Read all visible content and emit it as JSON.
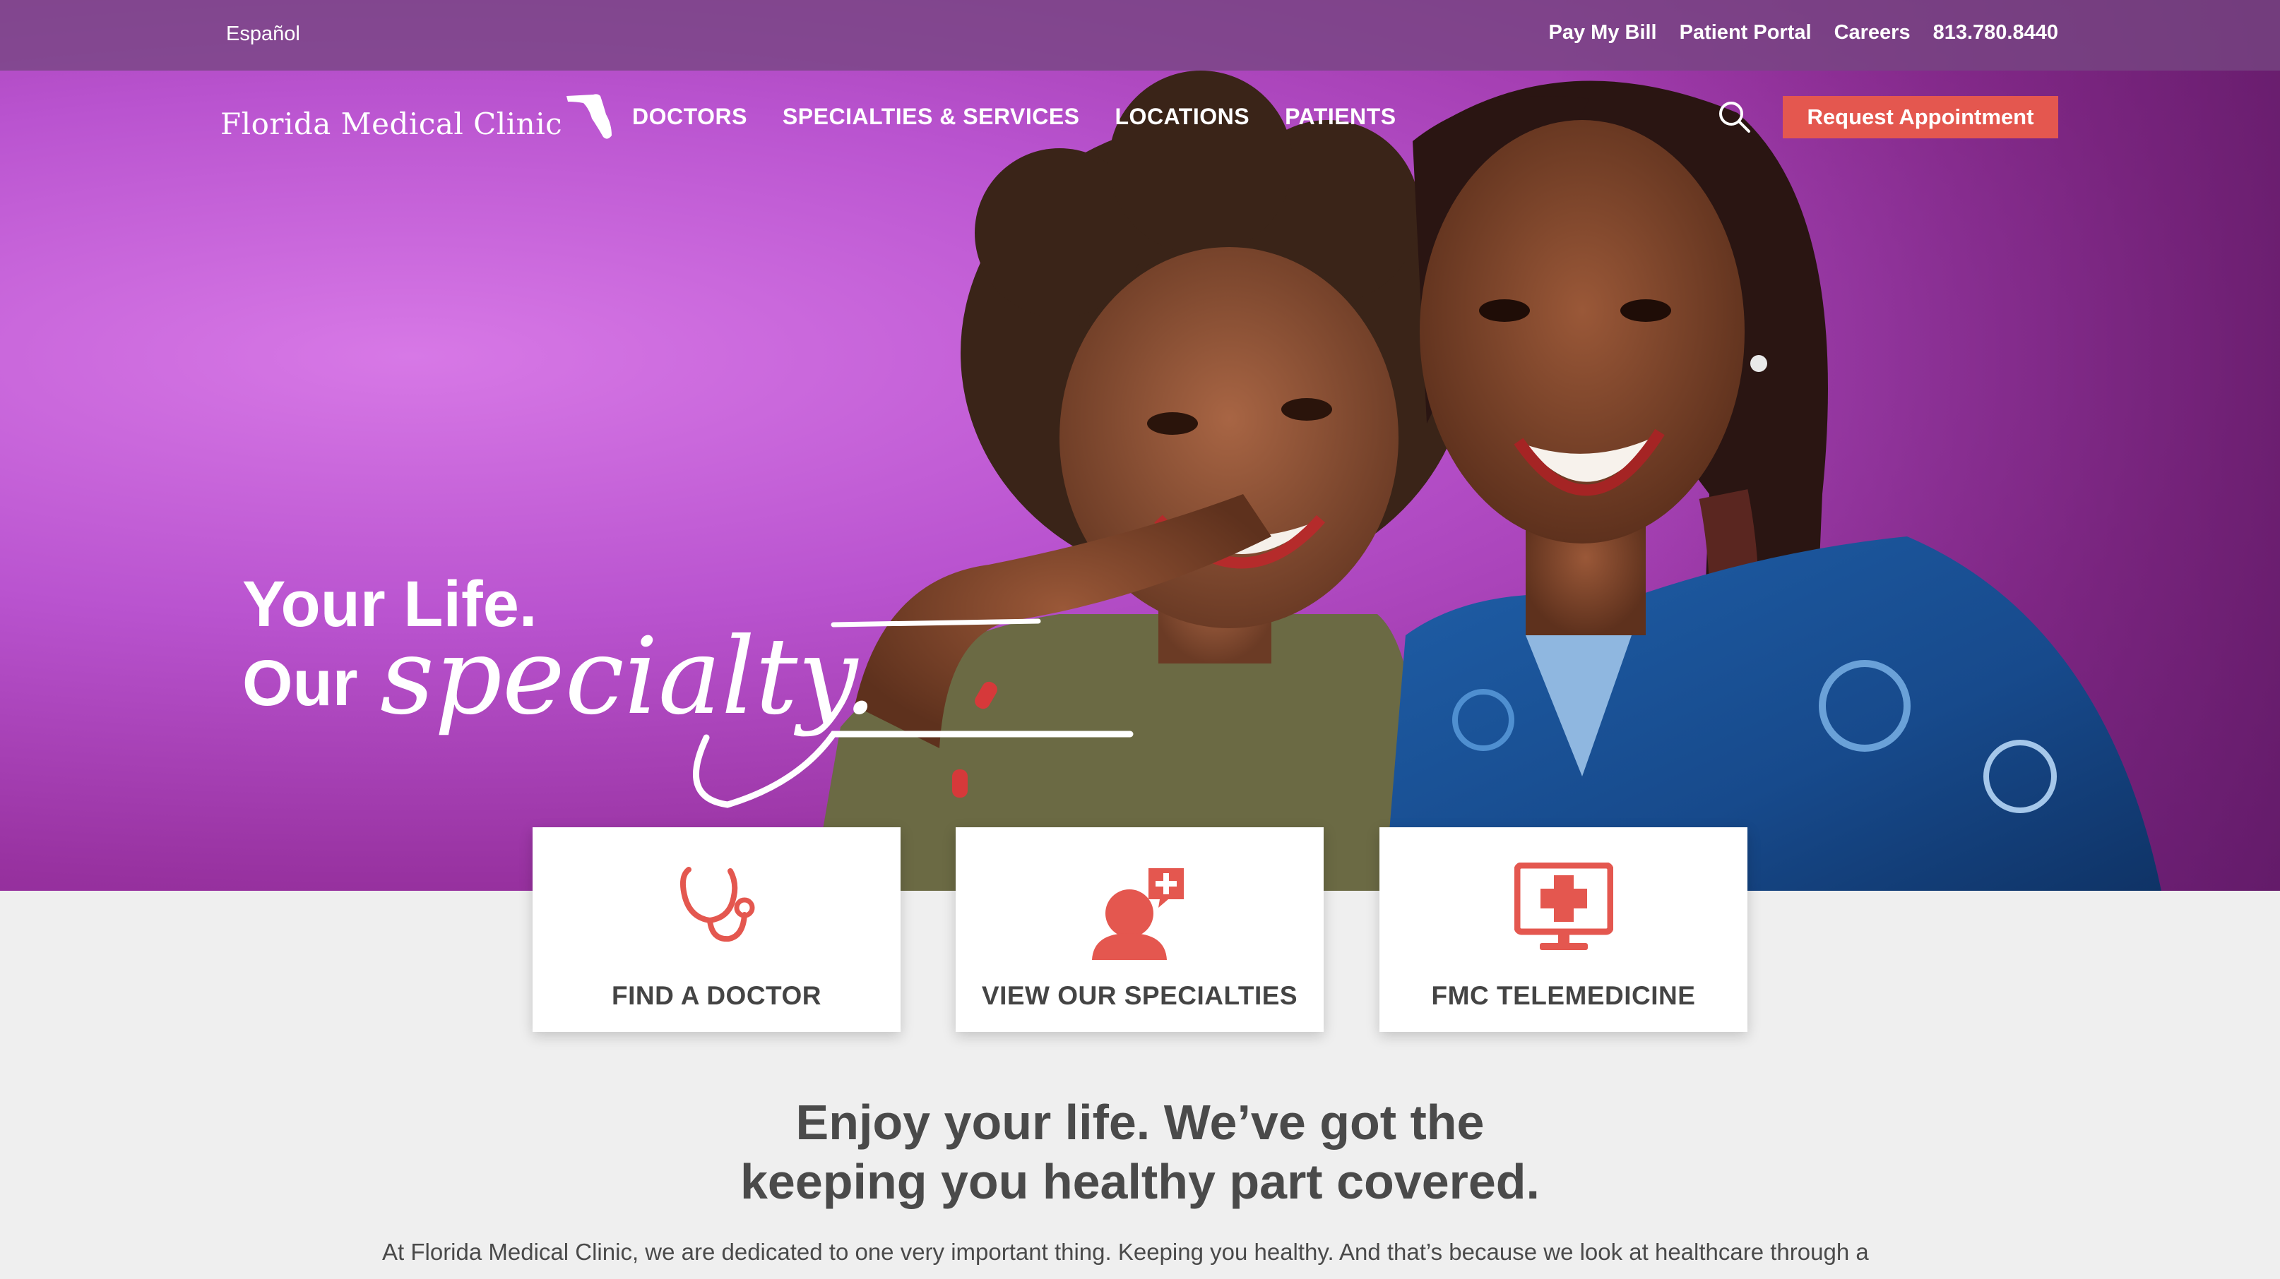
{
  "utility": {
    "language": "Español",
    "links": [
      "Pay My Bill",
      "Patient Portal",
      "Careers",
      "813.780.8440"
    ]
  },
  "brand": {
    "name": "Florida Medical Clinic"
  },
  "nav": {
    "items": [
      "DOCTORS",
      "SPECIALTIES & SERVICES",
      "LOCATIONS",
      "PATIENTS"
    ],
    "cta": "Request Appointment"
  },
  "hero": {
    "line1": "Your Life.",
    "line2": "Our",
    "script_word": "specialty."
  },
  "cards": [
    {
      "label": "FIND A DOCTOR",
      "icon": "stethoscope-icon"
    },
    {
      "label": "VIEW OUR SPECIALTIES",
      "icon": "specialist-icon"
    },
    {
      "label": "FMC TELEMEDICINE",
      "icon": "telemedicine-icon"
    }
  ],
  "intro": {
    "title_line1": "Enjoy your life. We’ve got the",
    "title_line2": "keeping you healthy part covered.",
    "body": "At Florida Medical Clinic, we are dedicated to one very important thing. Keeping you healthy. And that’s because we look at healthcare through a"
  },
  "colors": {
    "accent": "#e4574f",
    "hero_purple": "#b953cf",
    "text": "#4a4a4a"
  }
}
